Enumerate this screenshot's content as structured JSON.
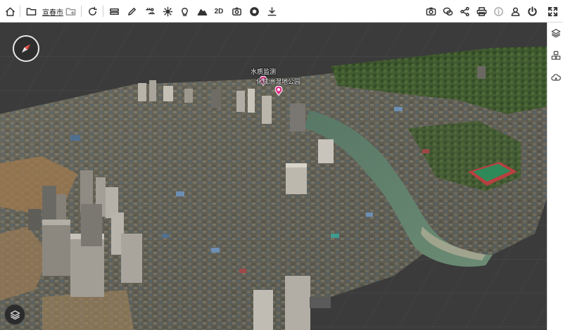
{
  "toolbar": {
    "location_label": "宣春市",
    "mode_2d_label": "2D",
    "left_buttons": [
      "home-icon",
      "folder-open-icon",
      "folder-add-icon",
      "refresh-icon",
      "layers-stack-icon",
      "pencil-icon",
      "measure-icon",
      "sun-icon",
      "bulb-icon",
      "terrain-icon",
      "screenshot-icon",
      "soccer-ball-icon",
      "download-icon"
    ],
    "right_buttons": [
      "camera-icon",
      "chat-icon",
      "share-icon",
      "print-icon",
      "info-icon",
      "user-icon",
      "power-icon",
      "fullscreen-icon"
    ]
  },
  "sidebar": {
    "buttons": [
      "layers-icon",
      "cubes-icon",
      "cloud-icon"
    ]
  },
  "map": {
    "pois": [
      {
        "label": "水质监测"
      },
      {
        "label": "化成洲湿地公园"
      }
    ],
    "colors": {
      "ground": "#3b3b3b",
      "grid": "#4a4a4a",
      "river": "#5f7f66",
      "vegetation": "#3e5a2c",
      "field": "#2f8a5a",
      "pin": "#e0318a"
    }
  }
}
